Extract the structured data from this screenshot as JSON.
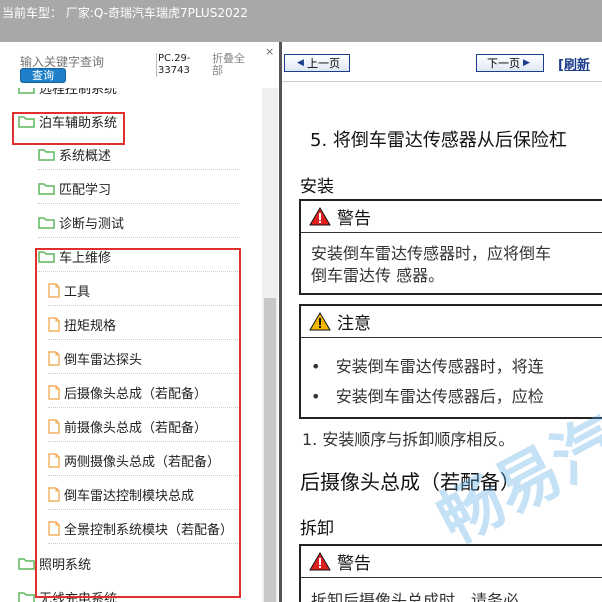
{
  "window": {
    "title": "当前车型： 厂家:Q-奇瑞汽车瑞虎7PLUS2022"
  },
  "sidebar": {
    "search": {
      "placeholder": "输入关键字查询",
      "button": "查询"
    },
    "pc_code": "PC.29-33743",
    "collapse_all": "折叠全部",
    "close_glyph": "×",
    "tree": [
      {
        "label": "远程控制系统",
        "type": "folder",
        "level": 0
      },
      {
        "label": "泊车辅助系统",
        "type": "folder",
        "level": 0,
        "highlighted": true
      },
      {
        "label": "系统概述",
        "type": "folder",
        "level": 1
      },
      {
        "label": "匹配学习",
        "type": "folder",
        "level": 1
      },
      {
        "label": "诊断与测试",
        "type": "folder",
        "level": 1
      },
      {
        "label": "车上维修",
        "type": "folder",
        "level": 1,
        "highlighted": true
      },
      {
        "label": "工具",
        "type": "file",
        "level": 2
      },
      {
        "label": "扭矩规格",
        "type": "file",
        "level": 2
      },
      {
        "label": "倒车雷达探头",
        "type": "file",
        "level": 2
      },
      {
        "label": "后摄像头总成（若配备）",
        "type": "file",
        "level": 2
      },
      {
        "label": "前摄像头总成（若配备）",
        "type": "file",
        "level": 2
      },
      {
        "label": "两侧摄像头总成（若配备）",
        "type": "file",
        "level": 2
      },
      {
        "label": "倒车雷达控制模块总成",
        "type": "file",
        "level": 2
      },
      {
        "label": "全景控制系统模块（若配备）",
        "type": "file",
        "level": 2
      },
      {
        "label": "照明系统",
        "type": "folder",
        "level": 0
      },
      {
        "label": "无线充电系统",
        "type": "folder",
        "level": 0
      }
    ]
  },
  "content": {
    "nav": {
      "prev": "上一页",
      "next": "下一页",
      "refresh": "[刷新"
    },
    "step5": "5.  将倒车雷达传感器从后保险杠",
    "install_heading": "安装",
    "warning1": {
      "title": "警告",
      "lines": [
        "安装倒车雷达传感器时，应将倒车",
        "倒车雷达传 感器。"
      ]
    },
    "caution": {
      "title": "注意",
      "bullets": [
        "安装倒车雷达传感器时，将连",
        "安装倒车雷达传感器后，应检"
      ]
    },
    "step1": "1.  安装顺序与拆卸顺序相反。",
    "section_heading": "后摄像头总成（若配备）",
    "remove_heading": "拆卸",
    "warning2": {
      "title": "警告",
      "lines": [
        "拆卸后摄像头总成时，请务必"
      ]
    },
    "watermark": "畅易汽"
  },
  "colors": {
    "highlight": "#e0302e",
    "folder": "#5cb85c",
    "file": "#f0a040",
    "accent": "#1f7fc8"
  }
}
